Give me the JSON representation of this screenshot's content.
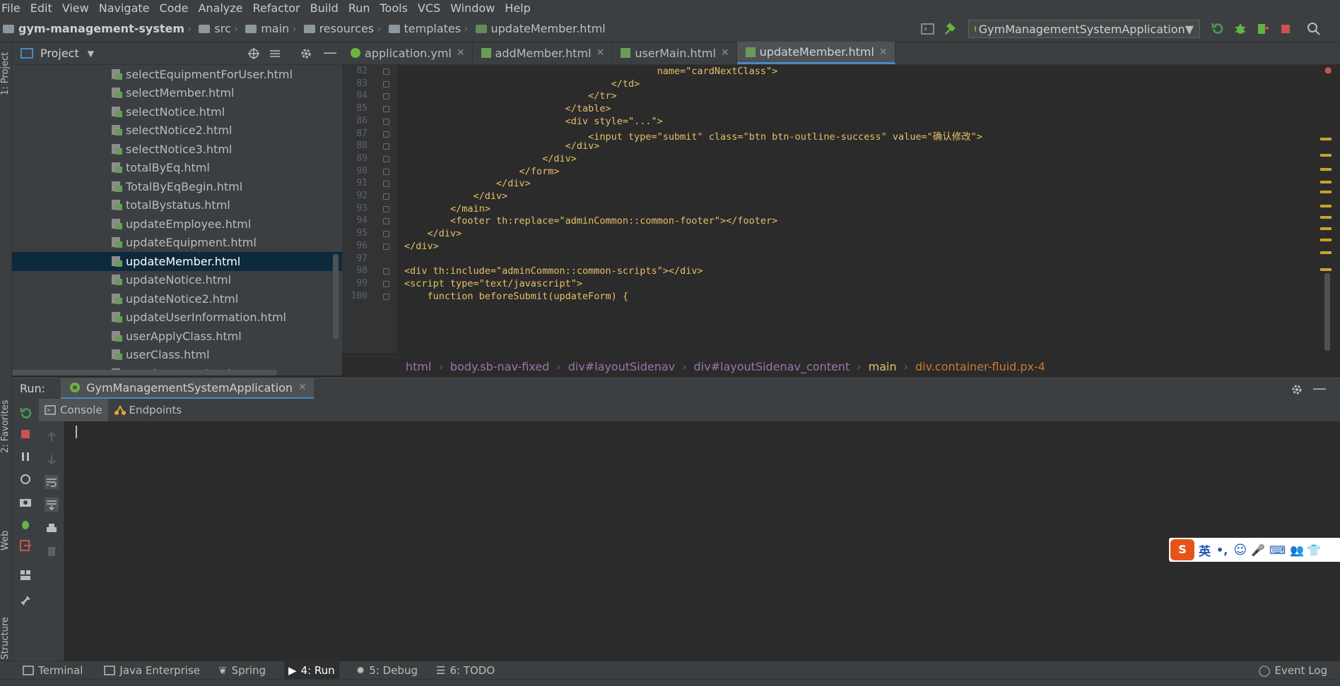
{
  "menu": [
    "File",
    "Edit",
    "View",
    "Navigate",
    "Code",
    "Analyze",
    "Refactor",
    "Build",
    "Run",
    "Tools",
    "VCS",
    "Window",
    "Help"
  ],
  "nav": {
    "crumbs": [
      "gym-management-system",
      "src",
      "main",
      "resources",
      "templates",
      "updateMember.html"
    ],
    "run_config": "GymManagementSystemApplication"
  },
  "left_strip": {
    "project": "1: Project",
    "favorites": "2: Favorites",
    "web": "Web",
    "structure": "Z: Structure"
  },
  "project": {
    "title": "Project",
    "files": [
      "selectEquipmentForUser.html",
      "selectMember.html",
      "selectNotice.html",
      "selectNotice2.html",
      "selectNotice3.html",
      "totalByEq.html",
      "TotalByEqBegin.html",
      "totalBystatus.html",
      "updateEmployee.html",
      "updateEquipment.html",
      "updateMember.html",
      "updateNotice.html",
      "updateNotice2.html",
      "updateUserInformation.html",
      "userApplyClass.html",
      "userClass.html",
      "userCommon.html"
    ],
    "selected": "updateMember.html"
  },
  "editor": {
    "tabs": [
      {
        "label": "application.yml",
        "active": false
      },
      {
        "label": "addMember.html",
        "active": false
      },
      {
        "label": "userMain.html",
        "active": false
      },
      {
        "label": "updateMember.html",
        "active": true
      }
    ],
    "line_numbers": [
      "82",
      "83",
      "84",
      "85",
      "86",
      "87",
      "88",
      "89",
      "90",
      "91",
      "92",
      "93",
      "94",
      "95",
      "96",
      "97",
      "98",
      "99",
      "100"
    ],
    "lines": [
      "                                            name=\"cardNextClass\">",
      "                                    </td>",
      "                                </tr>",
      "                            </table>",
      "                            <div style=\"...\">",
      "                                <input type=\"submit\" class=\"btn btn-outline-success\" value=\"确认修改\">",
      "                            </div>",
      "                        </div>",
      "                    </form>",
      "                </div>",
      "            </div>",
      "        </main>",
      "        <footer th:replace=\"adminCommon::common-footer\"></footer>",
      "    </div>",
      "</div>",
      "",
      "<div th:include=\"adminCommon::common-scripts\"></div>",
      "<script type=\"text/javascript\">",
      "    function beforeSubmit(updateForm) {"
    ],
    "breadcrumbs": [
      "html",
      "body.sb-nav-fixed",
      "div#layoutSidenav",
      "div#layoutSidenav_content",
      "main",
      "div.container-fluid.px-4"
    ]
  },
  "run": {
    "label": "Run:",
    "config_tab": "GymManagementSystemApplication",
    "subtabs": [
      "Console",
      "Endpoints"
    ]
  },
  "bottom": [
    "Terminal",
    "Java Enterprise",
    "Spring",
    "4: Run",
    "5: Debug",
    "6: TODO"
  ],
  "event_log": "Event Log",
  "ime": {
    "lang": "英"
  },
  "colors": {
    "accent": "#4a88c7",
    "tag": "#e8bf6a",
    "attr": "#bababa",
    "string": "#6a8759",
    "selection": "#0d293e"
  }
}
